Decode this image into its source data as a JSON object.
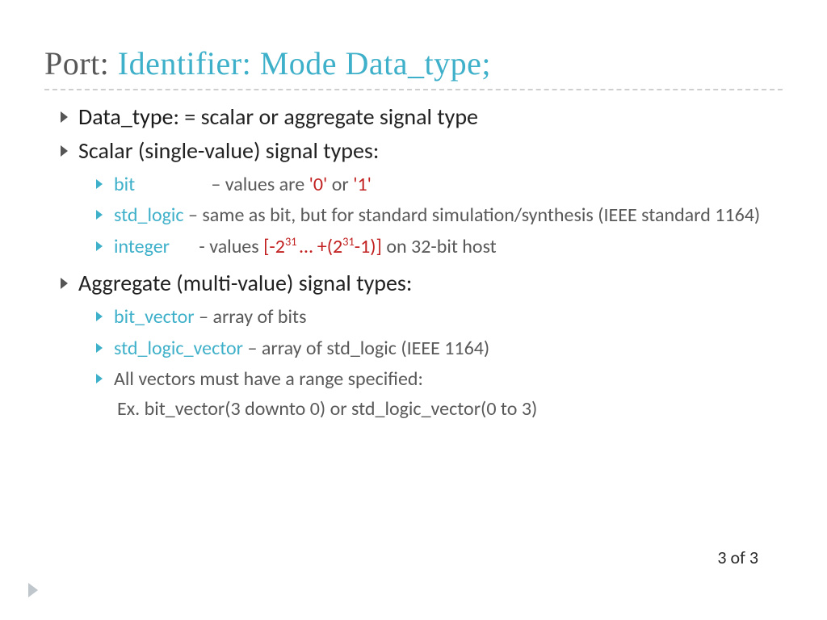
{
  "title": {
    "part_a": "Port:  ",
    "part_b": "Identifier:  Mode Data_type;"
  },
  "bullets": {
    "datatype_label": "Data_type",
    "datatype_def": ": = scalar or aggregate signal type",
    "scalar_heading": "Scalar (single-value) signal types:",
    "scalar_items": {
      "bit": {
        "kw": "bit",
        "dash": " – values are ",
        "lit0": "'0'",
        "mid": " or ",
        "lit1": "'1'"
      },
      "std": {
        "kw": "std_logic",
        "body": " – same as bit, but for standard simulation/synthesis (IEEE standard 1164)"
      },
      "int": {
        "kw": "integer",
        "pre": "  - values ",
        "range_open": "[-2",
        "exp1": "31 ",
        "range_mid": "… +(2",
        "exp2": "31",
        "range_tail": "-1)]",
        "post": " on 32-bit host"
      }
    },
    "aggregate_heading": "Aggregate (multi-value) signal types:",
    "aggregate_items": {
      "bv": {
        "kw": "bit_vector",
        "body": " – array of bits"
      },
      "slv": {
        "kw": "std_logic_vector",
        "body": " – array of std_logic (IEEE 1164)"
      },
      "range_note": "All vectors must have a range specified:",
      "range_ex": "Ex.   bit_vector(3 downto 0) or std_logic_vector(0 to 3)"
    }
  },
  "pager": "3 of 3"
}
